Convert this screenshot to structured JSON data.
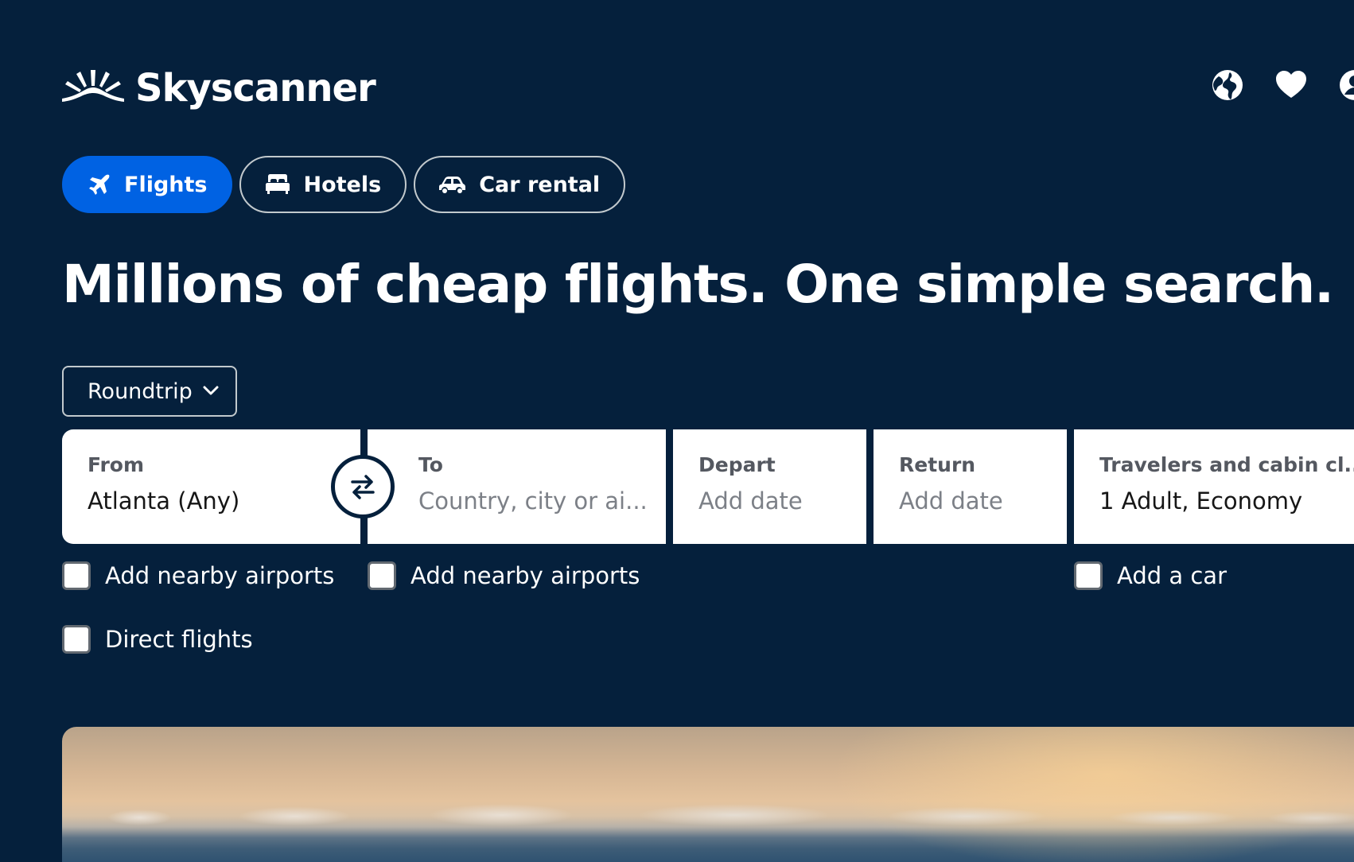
{
  "brand": {
    "name": "Skyscanner"
  },
  "header": {
    "icons": [
      "globe-icon",
      "heart-icon",
      "account-icon"
    ]
  },
  "tabs": [
    {
      "label": "Flights",
      "icon": "plane-icon",
      "active": true
    },
    {
      "label": "Hotels",
      "icon": "bed-icon",
      "active": false
    },
    {
      "label": "Car rental",
      "icon": "car-icon",
      "active": false
    }
  ],
  "headline": "Millions of cheap flights. One simple search.",
  "trip_type": {
    "selected": "Roundtrip"
  },
  "search": {
    "from": {
      "label": "From",
      "value": "Atlanta (Any)"
    },
    "to": {
      "label": "To",
      "placeholder": "Country, city or ai..."
    },
    "depart": {
      "label": "Depart",
      "placeholder": "Add date"
    },
    "return": {
      "label": "Return",
      "placeholder": "Add date"
    },
    "travelers": {
      "label": "Travelers and cabin cl...",
      "value": "1 Adult, Economy"
    }
  },
  "options": {
    "nearby_from": "Add nearby airports",
    "nearby_to": "Add nearby airports",
    "add_car": "Add a car",
    "direct": "Direct flights"
  },
  "colors": {
    "background": "#05203c",
    "accent": "#0062e3",
    "text_on_dark": "#ffffff"
  }
}
